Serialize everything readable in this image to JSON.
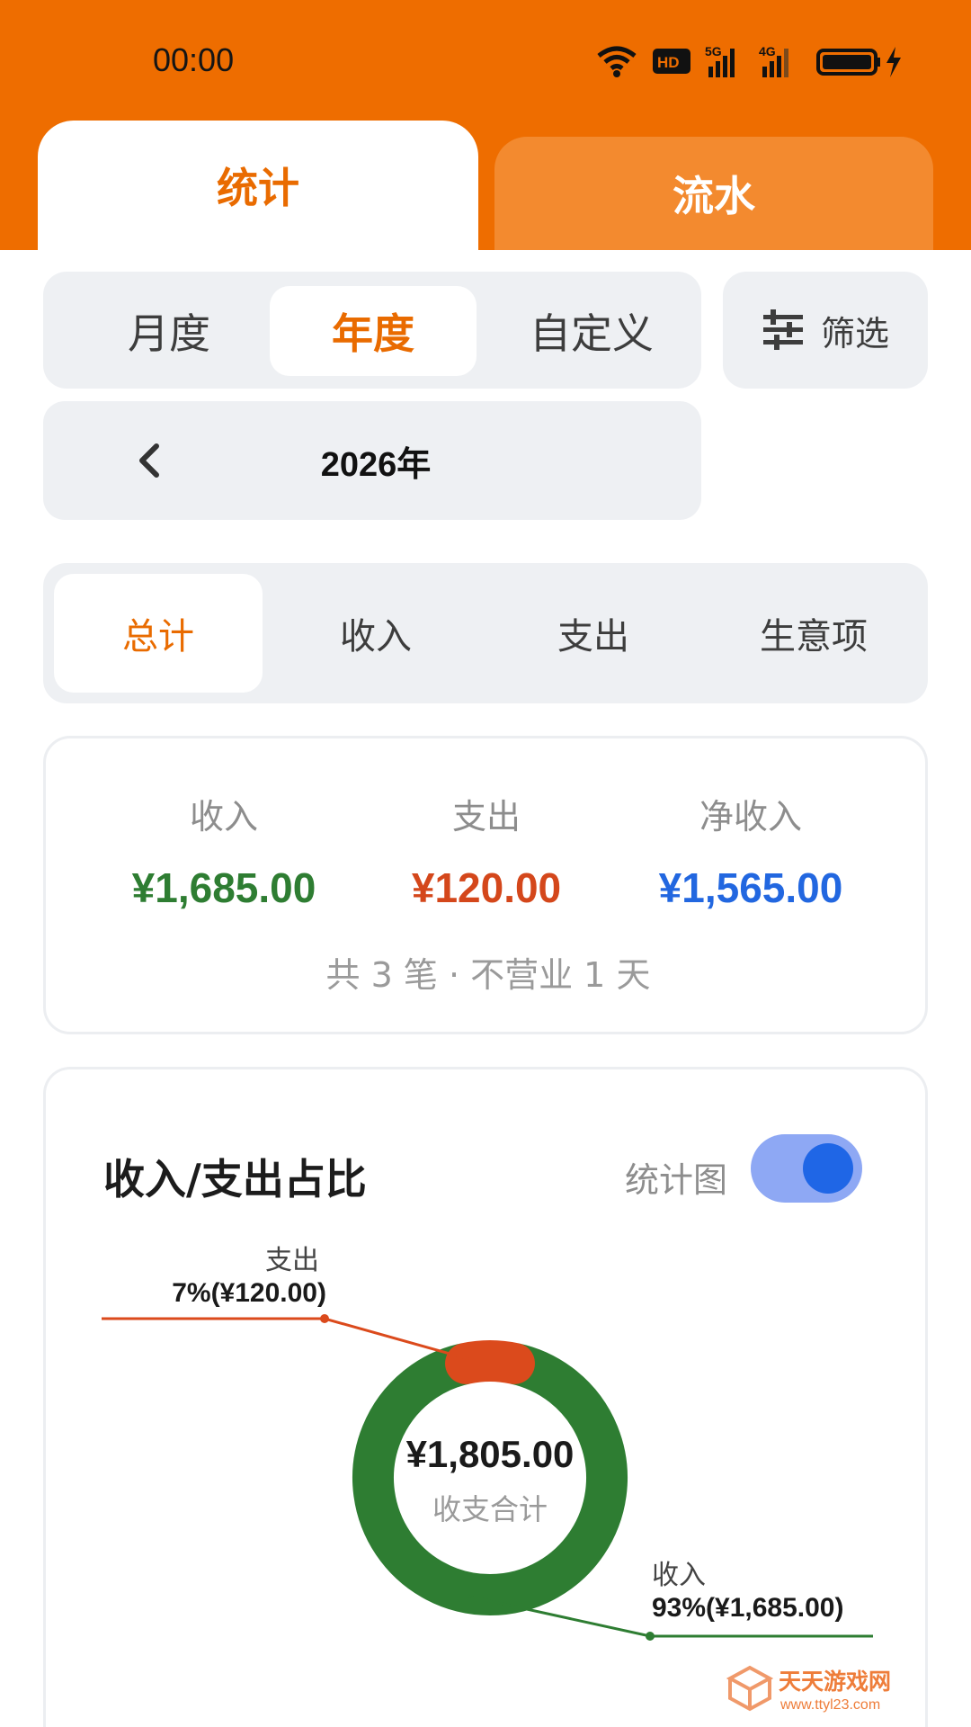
{
  "status": {
    "time": "00:00"
  },
  "tabs": {
    "stats": "统计",
    "flow": "流水"
  },
  "period": {
    "options": [
      "月度",
      "年度",
      "自定义"
    ],
    "selected": "年度",
    "filter_label": "筛选",
    "year_label": "2026年"
  },
  "type_tabs": {
    "options": [
      "总计",
      "收入",
      "支出",
      "生意项"
    ],
    "selected": "总计"
  },
  "summary": {
    "income_label": "收入",
    "income_value": "¥1,685.00",
    "expense_label": "支出",
    "expense_value": "¥120.00",
    "net_label": "净收入",
    "net_value": "¥1,565.00",
    "note": "共 3 笔 · 不营业 1 天"
  },
  "chart_card": {
    "title": "收入/支出占比",
    "toggle_label": "统计图",
    "toggle_on": true
  },
  "chart_data": {
    "type": "pie",
    "variant": "donut",
    "center_value": "¥1,805.00",
    "center_label": "收支合计",
    "slices": [
      {
        "name": "支出",
        "value": 120.0,
        "percent": 7,
        "label": "7%(¥120.00)",
        "color": "#db4a1c"
      },
      {
        "name": "收入",
        "value": 1685.0,
        "percent": 93,
        "label": "93%(¥1,685.00)",
        "color": "#2e7d32"
      }
    ]
  },
  "colors": {
    "brand": "#ee6d00",
    "income": "#2e7d32",
    "expense": "#d4471b",
    "net": "#2267e0"
  },
  "watermark": {
    "cn": "天天游戏网",
    "url": "www.ttyl23.com"
  }
}
